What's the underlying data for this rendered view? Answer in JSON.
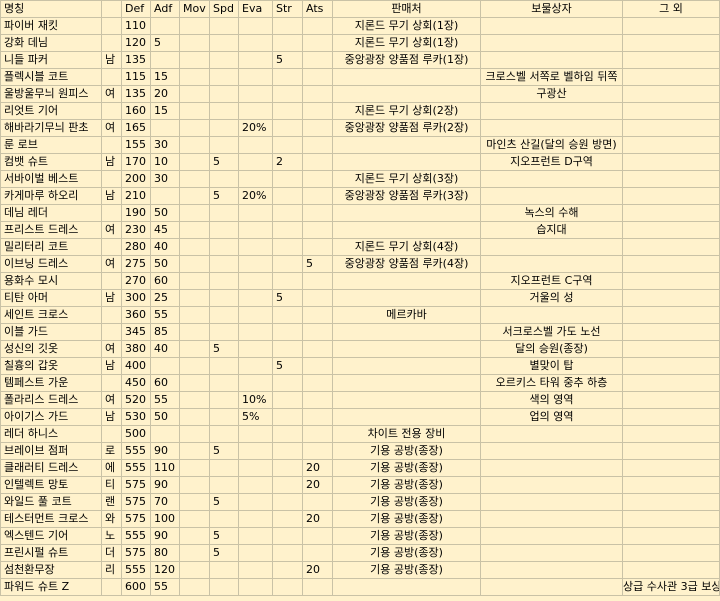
{
  "headers": [
    "명칭",
    "",
    "Def",
    "Adf",
    "Mov",
    "Spd",
    "Eva",
    "Str",
    "Ats",
    "판매처",
    "보물상자",
    "그 외"
  ],
  "rows": [
    [
      "파이버 재킷",
      "",
      "110",
      "",
      "",
      "",
      "",
      "",
      "",
      "지론드 무기 상회(1장)",
      "",
      ""
    ],
    [
      "강화 데님",
      "",
      "120",
      "5",
      "",
      "",
      "",
      "",
      "",
      "지론드 무기 상회(1장)",
      "",
      ""
    ],
    [
      "니들 파커",
      "남",
      "135",
      "",
      "",
      "",
      "",
      "5",
      "",
      "중앙광장 양품점 루카(1장)",
      "",
      ""
    ],
    [
      "플렉시블 코트",
      "",
      "115",
      "15",
      "",
      "",
      "",
      "",
      "",
      "",
      "크로스벨 서쪽로 벨하임 뒤쪽",
      ""
    ],
    [
      "울방울무늬 원피스",
      "여",
      "135",
      "20",
      "",
      "",
      "",
      "",
      "",
      "",
      "구광산",
      ""
    ],
    [
      "리엇트 기어",
      "",
      "160",
      "15",
      "",
      "",
      "",
      "",
      "",
      "지론드 무기 상회(2장)",
      "",
      ""
    ],
    [
      "해바라기무늬 판초",
      "여",
      "165",
      "",
      "",
      "",
      "20%",
      "",
      "",
      "중앙광장 양품점 루카(2장)",
      "",
      ""
    ],
    [
      "룬 로브",
      "",
      "155",
      "30",
      "",
      "",
      "",
      "",
      "",
      "",
      "마인츠 산길(달의 승원 방면)",
      ""
    ],
    [
      "컴뱃 슈트",
      "남",
      "170",
      "10",
      "",
      "5",
      "",
      "2",
      "",
      "",
      "지오프런트 D구역",
      ""
    ],
    [
      "서바이벌 베스트",
      "",
      "200",
      "30",
      "",
      "",
      "",
      "",
      "",
      "지론드 무기 상회(3장)",
      "",
      ""
    ],
    [
      "카게마루 하오리",
      "남",
      "210",
      "",
      "",
      "5",
      "20%",
      "",
      "",
      "중앙광장 양품점 루카(3장)",
      "",
      ""
    ],
    [
      "데님 레더",
      "",
      "190",
      "50",
      "",
      "",
      "",
      "",
      "",
      "",
      "녹스의 수해",
      ""
    ],
    [
      "프리스트 드레스",
      "여",
      "230",
      "45",
      "",
      "",
      "",
      "",
      "",
      "",
      "습지대",
      ""
    ],
    [
      "밀리터리 코트",
      "",
      "280",
      "40",
      "",
      "",
      "",
      "",
      "",
      "지론드 무기 상회(4장)",
      "",
      ""
    ],
    [
      "이브닝 드레스",
      "여",
      "275",
      "50",
      "",
      "",
      "",
      "",
      "5",
      "중앙광장 양품점 루카(4장)",
      "",
      ""
    ],
    [
      "용화수 모시",
      "",
      "270",
      "60",
      "",
      "",
      "",
      "",
      "",
      "",
      "지오프런트 C구역",
      ""
    ],
    [
      "티탄 아머",
      "남",
      "300",
      "25",
      "",
      "",
      "",
      "5",
      "",
      "",
      "거울의 성",
      ""
    ],
    [
      "세인트 크로스",
      "",
      "360",
      "55",
      "",
      "",
      "",
      "",
      "",
      "메르카바",
      "",
      ""
    ],
    [
      "이블 가드",
      "",
      "345",
      "85",
      "",
      "",
      "",
      "",
      "",
      "",
      "서크로스벨 가도 노선",
      ""
    ],
    [
      "성신의 깃옷",
      "여",
      "380",
      "40",
      "",
      "5",
      "",
      "",
      "",
      "",
      "달의 승원(종장)",
      ""
    ],
    [
      "칠흉의 갑옷",
      "남",
      "400",
      "",
      "",
      "",
      "",
      "5",
      "",
      "",
      "별맞이 탑",
      ""
    ],
    [
      "템페스트 가운",
      "",
      "450",
      "60",
      "",
      "",
      "",
      "",
      "",
      "",
      "오르키스 타워 중추 하층",
      ""
    ],
    [
      "폴라리스 드레스",
      "여",
      "520",
      "55",
      "",
      "",
      "10%",
      "",
      "",
      "",
      "색의 영역",
      ""
    ],
    [
      "아이기스 가드",
      "남",
      "530",
      "50",
      "",
      "",
      "5%",
      "",
      "",
      "",
      "업의 영역",
      ""
    ],
    [
      "레더 하니스",
      "",
      "500",
      "",
      "",
      "",
      "",
      "",
      "",
      "차이트 전용 장비",
      "",
      ""
    ],
    [
      "브레이브 점퍼",
      "로",
      "555",
      "90",
      "",
      "5",
      "",
      "",
      "",
      "기용 공방(종장)",
      "",
      ""
    ],
    [
      "클래러티 드레스",
      "에",
      "555",
      "110",
      "",
      "",
      "",
      "",
      "20",
      "기용 공방(종장)",
      "",
      ""
    ],
    [
      "인텔렉트 망토",
      "티",
      "575",
      "90",
      "",
      "",
      "",
      "",
      "20",
      "기용 공방(종장)",
      "",
      ""
    ],
    [
      "와일드 풀 코트",
      "랜",
      "575",
      "70",
      "",
      "5",
      "",
      "",
      "",
      "기용 공방(종장)",
      "",
      ""
    ],
    [
      "테스터먼트 크로스",
      "와",
      "575",
      "100",
      "",
      "",
      "",
      "",
      "20",
      "기용 공방(종장)",
      "",
      ""
    ],
    [
      "엑스텐드 기어",
      "노",
      "555",
      "90",
      "",
      "5",
      "",
      "",
      "",
      "기용 공방(종장)",
      "",
      ""
    ],
    [
      "프린시펄 슈트",
      "더",
      "575",
      "80",
      "",
      "5",
      "",
      "",
      "",
      "기용 공방(종장)",
      "",
      ""
    ],
    [
      "섬천환무장",
      "리",
      "555",
      "120",
      "",
      "",
      "",
      "",
      "20",
      "기용 공방(종장)",
      "",
      ""
    ],
    [
      "파워드 슈트 Z",
      "",
      "600",
      "55",
      "",
      "",
      "",
      "",
      "",
      "",
      "",
      "상급 수사관 3급 보상"
    ]
  ]
}
